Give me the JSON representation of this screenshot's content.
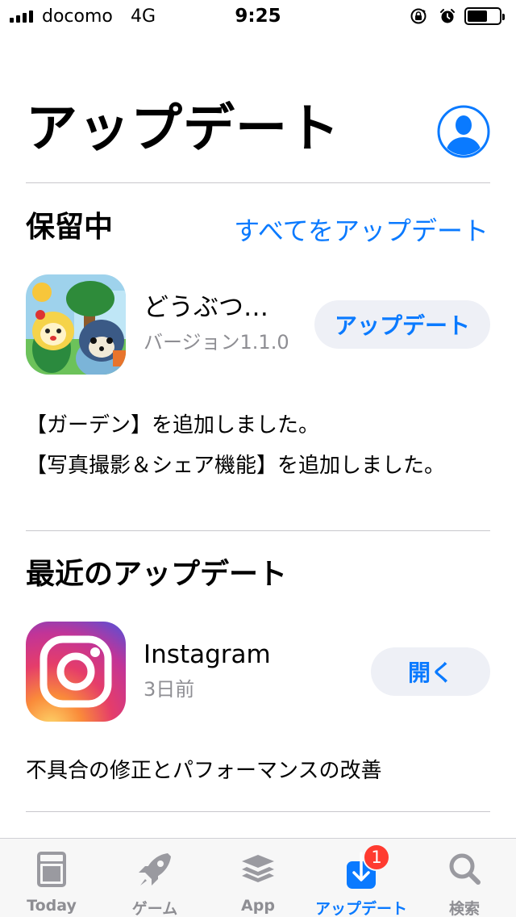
{
  "status_bar": {
    "carrier": "docomo",
    "network": "4G",
    "time": "9:25"
  },
  "header": {
    "title": "アップデート"
  },
  "pending": {
    "title": "保留中",
    "update_all_label": "すべてをアップデート",
    "app": {
      "name": "どうぶつ…",
      "version": "バージョン1.1.0",
      "button_label": "アップデート",
      "notes": [
        "【ガーデン】を追加しました。",
        "【写真撮影＆シェア機能】を追加しました。"
      ]
    }
  },
  "recent": {
    "title": "最近のアップデート",
    "app": {
      "name": "Instagram",
      "date": "3日前",
      "button_label": "開く",
      "notes": "不具合の修正とパフォーマンスの改善"
    }
  },
  "tab_bar": {
    "tabs": [
      {
        "label": "Today",
        "icon": "today-icon"
      },
      {
        "label": "ゲーム",
        "icon": "rocket-icon"
      },
      {
        "label": "App",
        "icon": "apps-stack-icon"
      },
      {
        "label": "アップデート",
        "icon": "download-icon",
        "badge": "1",
        "active": true
      },
      {
        "label": "検索",
        "icon": "search-icon"
      }
    ]
  },
  "colors": {
    "accent": "#0a7aff",
    "badge": "#ff3b30",
    "secondary_text": "#8e8e93"
  }
}
